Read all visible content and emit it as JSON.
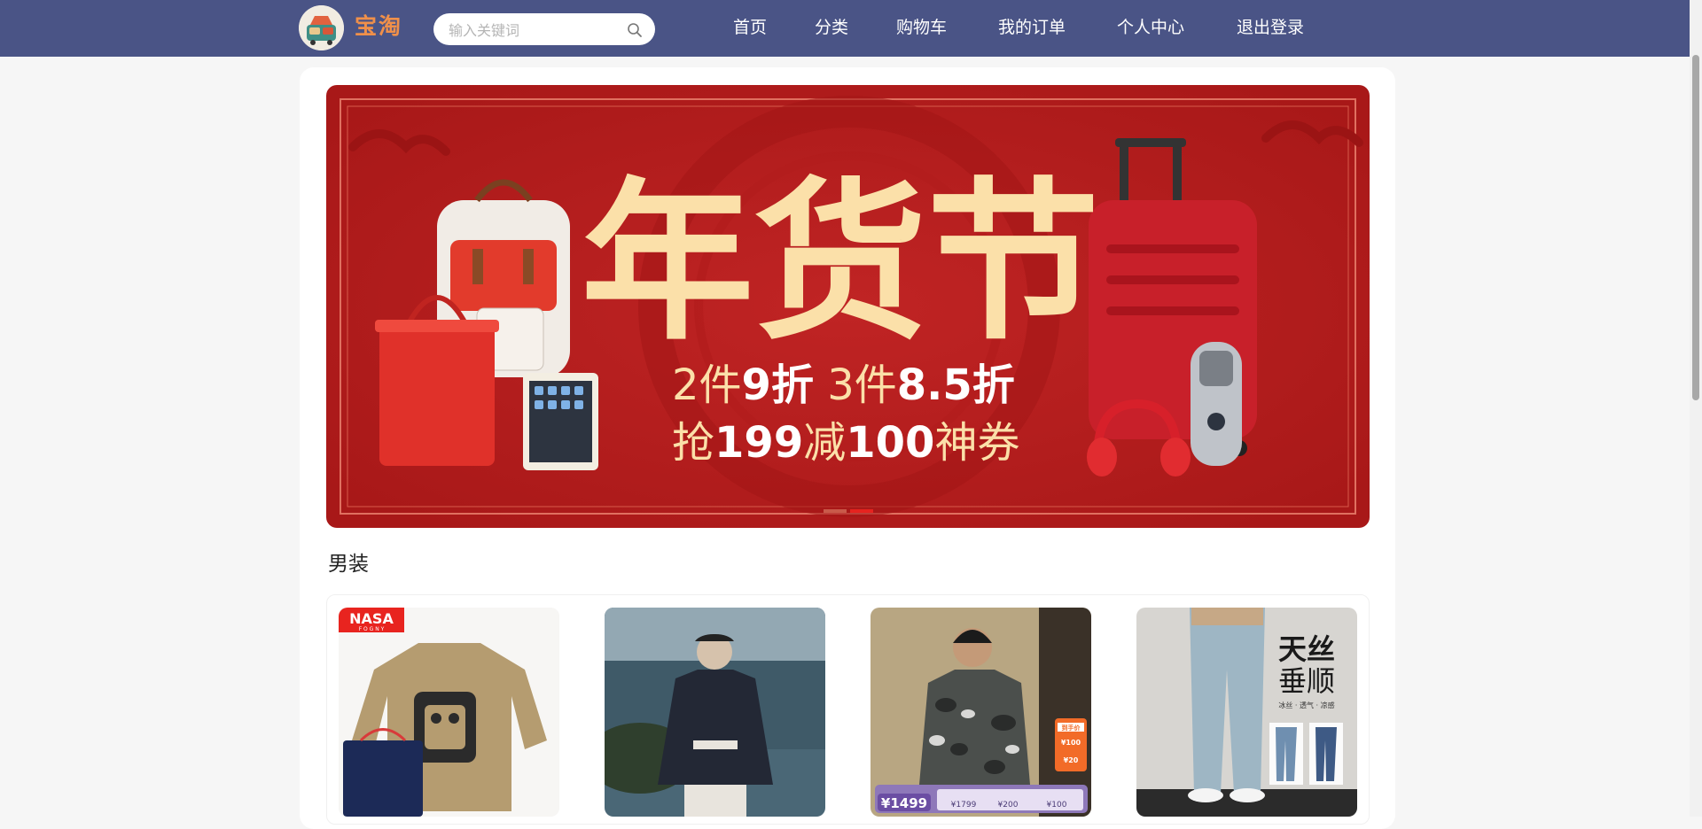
{
  "header": {
    "logo_icon": "shop-cart-logo-icon",
    "brand": "宝淘",
    "search": {
      "placeholder": "输入关键词",
      "value": "",
      "icon": "search-icon"
    },
    "nav": [
      "首页",
      "分类",
      "购物车",
      "我的订单",
      "个人中心",
      "退出登录"
    ]
  },
  "banner": {
    "title": "年货节",
    "line1_a": "2件",
    "line1_b": "9折",
    "line1_c": " 3件",
    "line1_d": "8.5折",
    "line2_a": "抢",
    "line2_b": "199",
    "line2_c": "减",
    "line2_d": "100",
    "line2_e": "神券",
    "carousel": {
      "slides": 2,
      "active": 2
    }
  },
  "section": {
    "title": "男装"
  },
  "products": [
    {
      "name": "product-sweater",
      "brand_tag": "NASA",
      "brand_sub": "F O G  N Y"
    },
    {
      "name": "product-jacket"
    },
    {
      "name": "product-camo-jacket",
      "badge": "到手价",
      "price": "¥1499",
      "sub_price_1": "¥1799",
      "sub_price_2": "¥200",
      "sub_price_3": "¥100",
      "coupon_1": "¥100",
      "coupon_2": "¥20"
    },
    {
      "name": "product-jeans",
      "headline_1": "天丝",
      "headline_2": "垂顺",
      "tagline": "冰丝 · 透气 · 凉感"
    }
  ],
  "colors": {
    "header_bg": "#4a5486",
    "brand": "#f0904a",
    "banner_red": "#b41d1d",
    "banner_gold": "#fbe0a9"
  }
}
